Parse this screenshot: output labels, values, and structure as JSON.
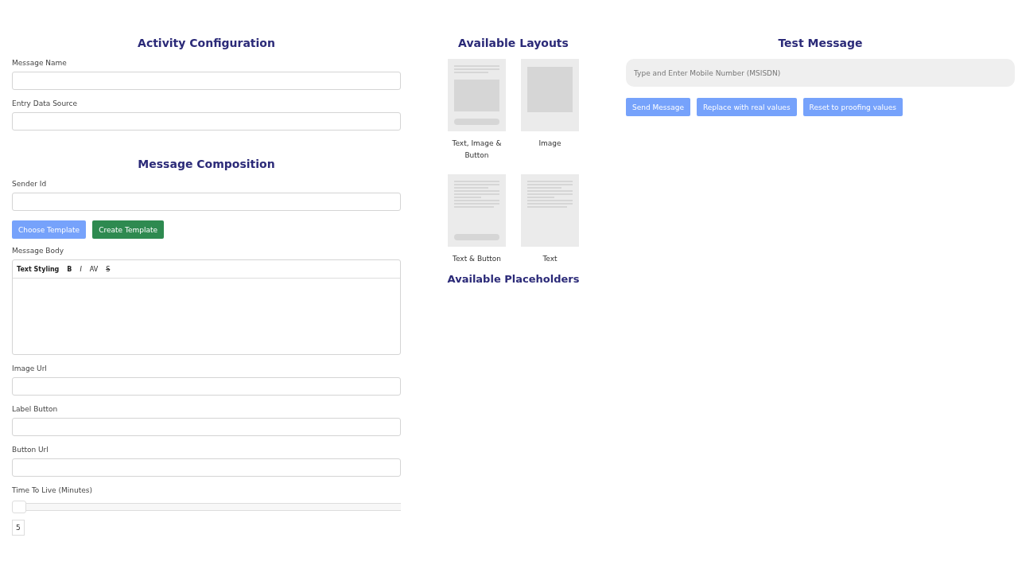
{
  "activity_configuration": {
    "title": "Activity Configuration",
    "fields": [
      {
        "label": "Message Name"
      },
      {
        "label": "Entry Data Source"
      }
    ]
  },
  "message_composition": {
    "title": "Message Composition",
    "sender": {
      "label": "Sender Id"
    },
    "template_buttons": [
      {
        "label": "Choose Template",
        "kind": "primary"
      },
      {
        "label": "Create Template",
        "kind": "success"
      }
    ],
    "message_body": {
      "label": "Message Body",
      "toolbar": [
        {
          "label": "Text Styling",
          "kind": "heading"
        },
        {
          "label": "B",
          "kind": "bold"
        },
        {
          "label": "I",
          "kind": "italic"
        },
        {
          "label": "AV",
          "kind": "spacing"
        },
        {
          "label": "S",
          "kind": "strike"
        }
      ]
    },
    "fields": [
      {
        "label": "Image Url"
      },
      {
        "label": "Label Button"
      },
      {
        "label": "Button Url"
      }
    ],
    "time_to_live": {
      "label": "Time To Live (Minutes)",
      "level": 0,
      "value": "5"
    }
  },
  "available_layouts": {
    "title": "Available Layouts",
    "layouts": [
      {
        "label": "Text, Image & Button",
        "kind": "text-image-button"
      },
      {
        "label": "Image",
        "kind": "image"
      },
      {
        "label": "Text & Button",
        "kind": "text-button"
      },
      {
        "label": "Text",
        "kind": "text"
      }
    ]
  },
  "available_placeholders": {
    "title": "Available Placeholders"
  },
  "test_message": {
    "title": "Test Message",
    "input": {
      "placeholder": "Type and Enter Mobile Number (MSISDN)"
    },
    "buttons": [
      {
        "label": "Send Message",
        "kind": "primary"
      },
      {
        "label": "Replace with real values",
        "kind": "primary"
      },
      {
        "label": "Reset to proofing values",
        "kind": "primary"
      }
    ]
  }
}
